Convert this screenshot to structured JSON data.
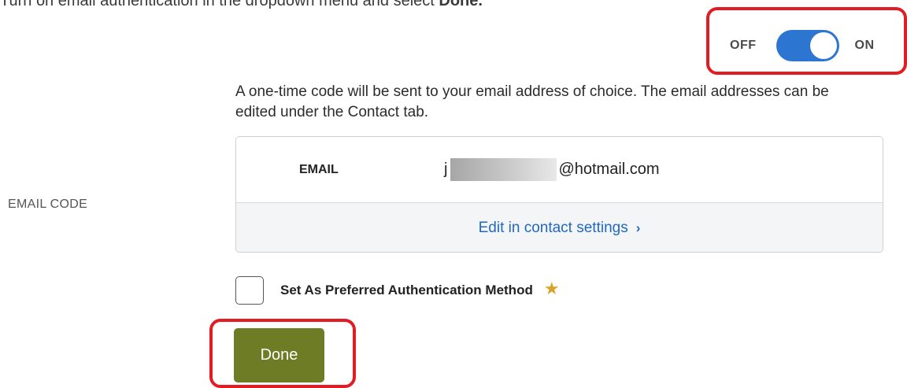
{
  "instruction": {
    "text": "Turn on email authentication in the dropdown menu and select ",
    "emphasis": "Done."
  },
  "toggle": {
    "off_label": "OFF",
    "on_label": "ON",
    "state": "on",
    "track_color": "#2c76d2"
  },
  "description": "A one-time code will be sent to your email address of choice. The email addresses can be edited under the Contact tab.",
  "section_label": "EMAIL CODE",
  "email_card": {
    "key_label": "EMAIL",
    "value_prefix": "j",
    "value_suffix": "@hotmail.com",
    "edit_link": "Edit in contact settings",
    "edit_chevron": "›"
  },
  "preferred": {
    "label": "Set As Preferred Authentication Method",
    "checked": false,
    "star": "★",
    "star_color": "#d8a327"
  },
  "done_button": {
    "label": "Done",
    "color": "#6e7d25"
  },
  "highlight_color": "#e31c23",
  "icons": {
    "chevron": "chevron-right-icon",
    "star": "star-icon"
  }
}
